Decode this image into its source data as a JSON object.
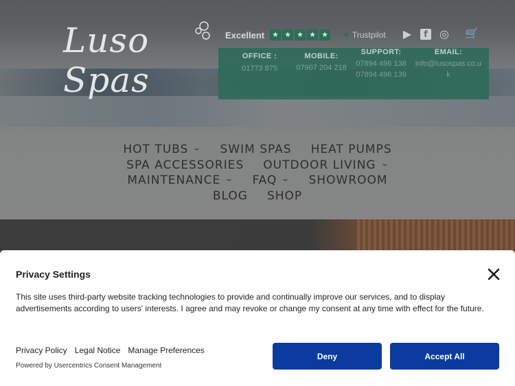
{
  "site": {
    "logo_text": "Luso Spas",
    "trustpilot": {
      "rating_label": "Excellent",
      "stars": [
        "★",
        "★",
        "★",
        "★",
        "★"
      ],
      "brand": "Trustpilot",
      "brand_star": "★"
    },
    "social_icons": [
      "youtube-icon",
      "facebook-icon",
      "instagram-icon"
    ],
    "social_glyphs": [
      "▶",
      "f",
      "◎"
    ],
    "cart_glyph": "🛒",
    "contact": {
      "office": {
        "label": "OFFICE :",
        "values": [
          "01773 875"
        ]
      },
      "mobile": {
        "label": "MOBILE:",
        "values": [
          "07907 204 218"
        ]
      },
      "support": {
        "label": "SUPPORT:",
        "values": [
          "07894 496 138",
          "07894 496 139"
        ]
      },
      "email": {
        "label": "EMAIL:",
        "values": [
          "info@lusospas.co.u",
          "k"
        ]
      }
    },
    "nav": {
      "row1": [
        {
          "label": "HOT TUBS",
          "dropdown": true
        },
        {
          "label": "SWIM SPAS",
          "dropdown": false
        },
        {
          "label": "HEAT PUMPS",
          "dropdown": false
        }
      ],
      "row2": [
        {
          "label": "SPA ACCESSORIES",
          "dropdown": false
        },
        {
          "label": "OUTDOOR LIVING",
          "dropdown": true
        }
      ],
      "row3": [
        {
          "label": "MAINTENANCE",
          "dropdown": true
        },
        {
          "label": "FAQ",
          "dropdown": true
        },
        {
          "label": "SHOWROOM",
          "dropdown": false
        }
      ],
      "row4": [
        {
          "label": "BLOG",
          "dropdown": false
        },
        {
          "label": "SHOP",
          "dropdown": false
        }
      ],
      "chevron": "⌄"
    }
  },
  "consent": {
    "title": "Privacy Settings",
    "description": "This site uses third-party website tracking technologies to provide and continually improve our services, and to display advertisements according to users' interests. I agree and may revoke or change my consent at any time with effect for the future.",
    "links": {
      "privacy_policy": "Privacy Policy",
      "legal_notice": "Legal Notice",
      "manage_preferences": "Manage Preferences"
    },
    "powered_by": "Powered by Usercentrics Consent Management",
    "deny_label": "Deny",
    "accept_label": "Accept All"
  },
  "colors": {
    "button_blue": "#0b3b9e",
    "contact_box_green": "#2f6b5a",
    "trustpilot_green": "#2a6e56"
  }
}
